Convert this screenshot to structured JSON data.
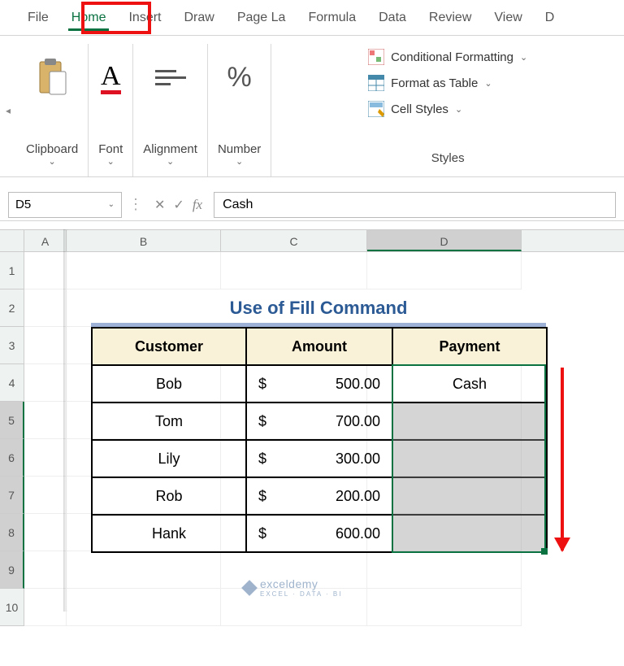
{
  "tabs": [
    "File",
    "Home",
    "Insert",
    "Draw",
    "Page La",
    "Formula",
    "Data",
    "Review",
    "View",
    "D"
  ],
  "active_tab": "Home",
  "ribbon_groups": {
    "clipboard": "Clipboard",
    "font": "Font",
    "alignment": "Alignment",
    "number": "Number",
    "styles": "Styles"
  },
  "style_buttons": {
    "cond_fmt": "Conditional Formatting",
    "as_table": "Format as Table",
    "cell_styles": "Cell Styles"
  },
  "name_box": "D5",
  "formula_value": "Cash",
  "columns": [
    "A",
    "B",
    "C",
    "D"
  ],
  "rows": [
    "1",
    "2",
    "3",
    "4",
    "5",
    "6",
    "7",
    "8",
    "9",
    "10"
  ],
  "title": "Use of Fill Command",
  "headers": {
    "b": "Customer",
    "c": "Amount",
    "d": "Payment"
  },
  "data": [
    {
      "customer": "Bob",
      "amount": "500.00",
      "payment": "Cash"
    },
    {
      "customer": "Tom",
      "amount": "700.00",
      "payment": ""
    },
    {
      "customer": "Lily",
      "amount": "300.00",
      "payment": ""
    },
    {
      "customer": "Rob",
      "amount": "200.00",
      "payment": ""
    },
    {
      "customer": "Hank",
      "amount": "600.00",
      "payment": ""
    }
  ],
  "currency": "$",
  "watermark": {
    "name": "exceldemy",
    "tag": "EXCEL · DATA · BI"
  },
  "selected_range": "D5:D9"
}
